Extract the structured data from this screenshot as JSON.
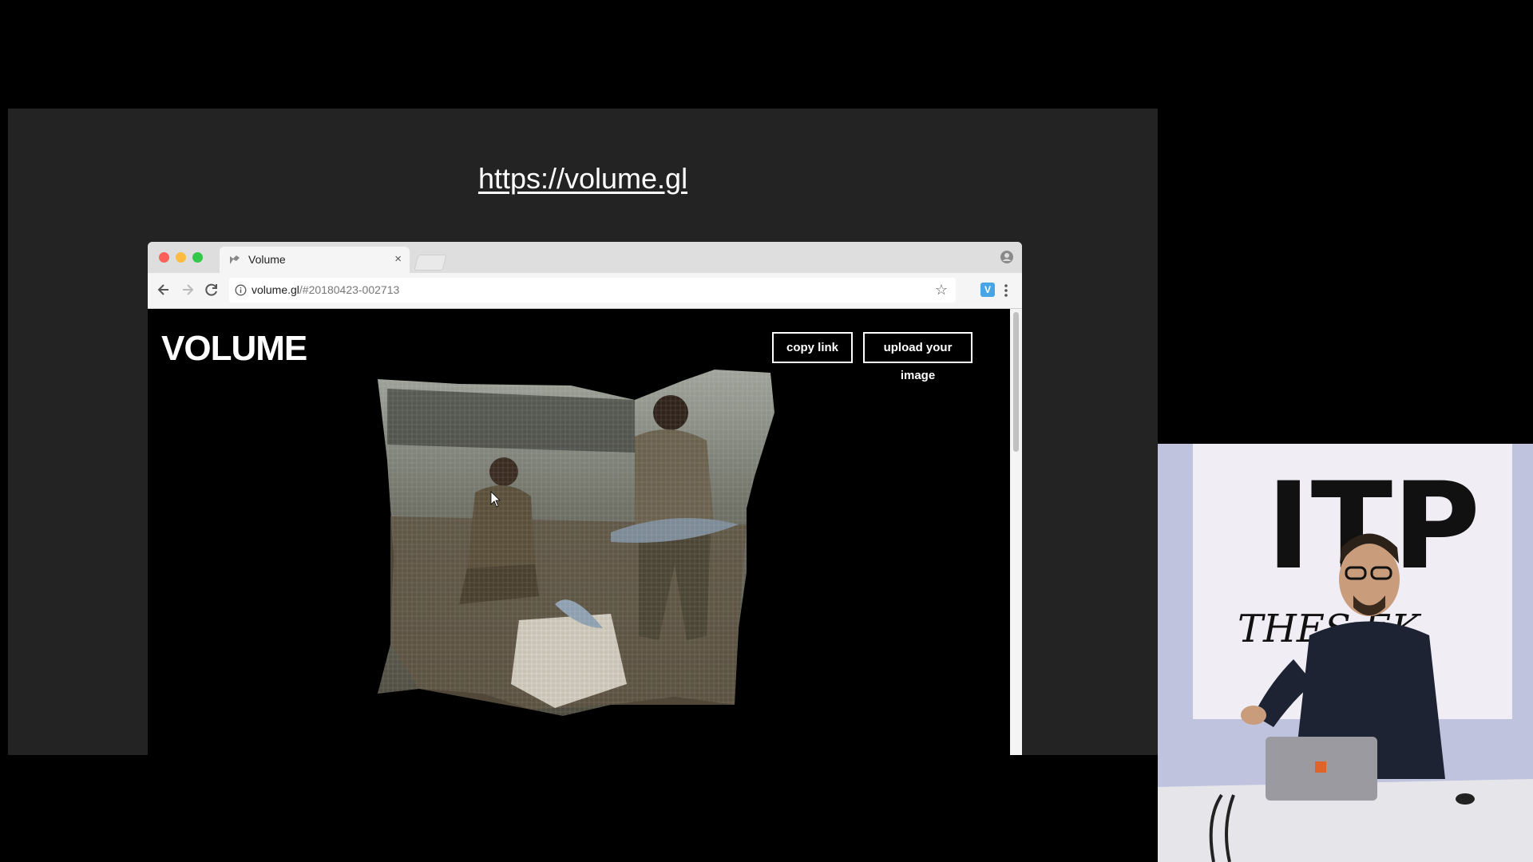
{
  "slide": {
    "url_heading": "https://volume.gl"
  },
  "browser": {
    "tab_title": "Volume",
    "tab_close": "×",
    "address_host": "volume.gl",
    "address_path": "/#20180423-002713",
    "extension_label": "V"
  },
  "page": {
    "logo": "VOLUME",
    "copy_link_label": "copy link",
    "upload_label": "upload your image"
  },
  "speaker": {
    "backdrop_title": "ITP",
    "backdrop_subtitle": "THES    EK"
  },
  "colors": {
    "slide_bg": "#232323",
    "traffic_red": "#fc605b",
    "traffic_yellow": "#fdbc40",
    "traffic_green": "#34c84a",
    "extension_blue": "#45a5e6"
  }
}
